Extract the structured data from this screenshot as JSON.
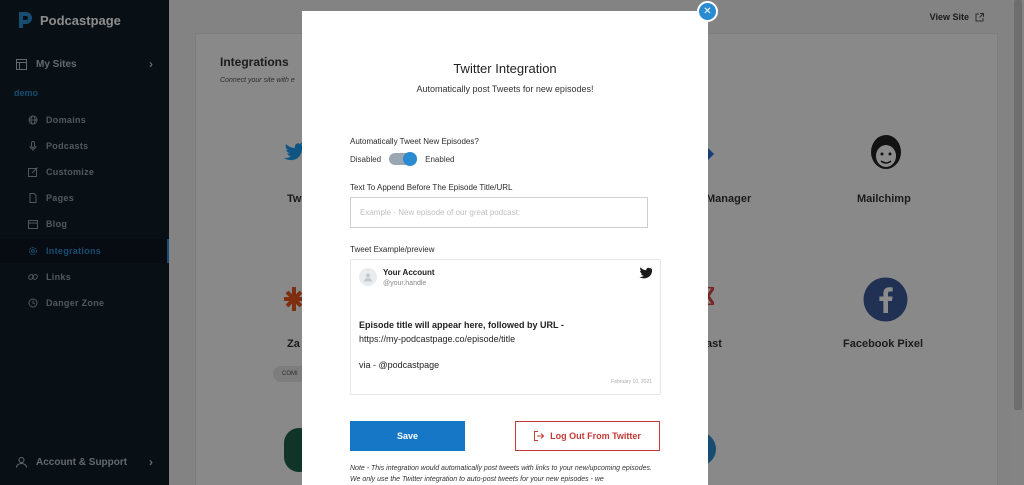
{
  "app": {
    "logo_text": "Podcastpage"
  },
  "sidebar": {
    "my_sites": "My Sites",
    "site_name": "demo",
    "items": [
      {
        "label": "Domains",
        "icon": "globe-icon"
      },
      {
        "label": "Podcasts",
        "icon": "microphone-icon"
      },
      {
        "label": "Customize",
        "icon": "edit-icon"
      },
      {
        "label": "Pages",
        "icon": "file-icon"
      },
      {
        "label": "Blog",
        "icon": "calendar-icon"
      },
      {
        "label": "Integrations",
        "icon": "gear-icon",
        "active": true
      },
      {
        "label": "Links",
        "icon": "link-icon"
      },
      {
        "label": "Danger Zone",
        "icon": "clock-icon"
      }
    ],
    "account": "Account & Support"
  },
  "topbar": {
    "view_site": "View Site"
  },
  "integrations_page": {
    "title": "Integrations",
    "subtitle": "Connect your site with e",
    "cards": [
      {
        "label": "Tw"
      },
      {
        "label": "Manager"
      },
      {
        "label": "Mailchimp"
      },
      {
        "label": "Za"
      },
      {
        "label": "COMI"
      },
      {
        "label": "ast"
      },
      {
        "label": "Facebook Pixel"
      }
    ]
  },
  "modal": {
    "close_icon": "close-icon",
    "title": "Twitter Integration",
    "subtitle": "Automatically post Tweets for new episodes!",
    "auto_tweet_label": "Automatically Tweet New Episodes?",
    "toggle": {
      "off_label": "Disabled",
      "on_label": "Enabled",
      "enabled": true
    },
    "append_label": "Text To Append Before The Episode Title/URL",
    "append_placeholder": "Example - New episode of our great podcast:",
    "append_value": "",
    "preview_label": "Tweet Example/preview",
    "tweet": {
      "account_name": "Your Account",
      "handle": "@your.handle",
      "body_bold": "Episode title will appear here, followed by URL -",
      "body_url": "https://my-podcastpage.co/episode/title",
      "via": "via - @podcastpage",
      "date": "February 10, 2021"
    },
    "save_label": "Save",
    "logout_label": "Log Out From Twitter",
    "note": "Note - This integration would automatically post tweets with links to your new/upcoming episodes. We only use the Twitter integration to auto-post tweets for your new episodes - we"
  },
  "colors": {
    "accent": "#2b8bd1",
    "sidebar_bg": "#101c27",
    "danger": "#c43a36",
    "save_button": "#1677c7"
  }
}
